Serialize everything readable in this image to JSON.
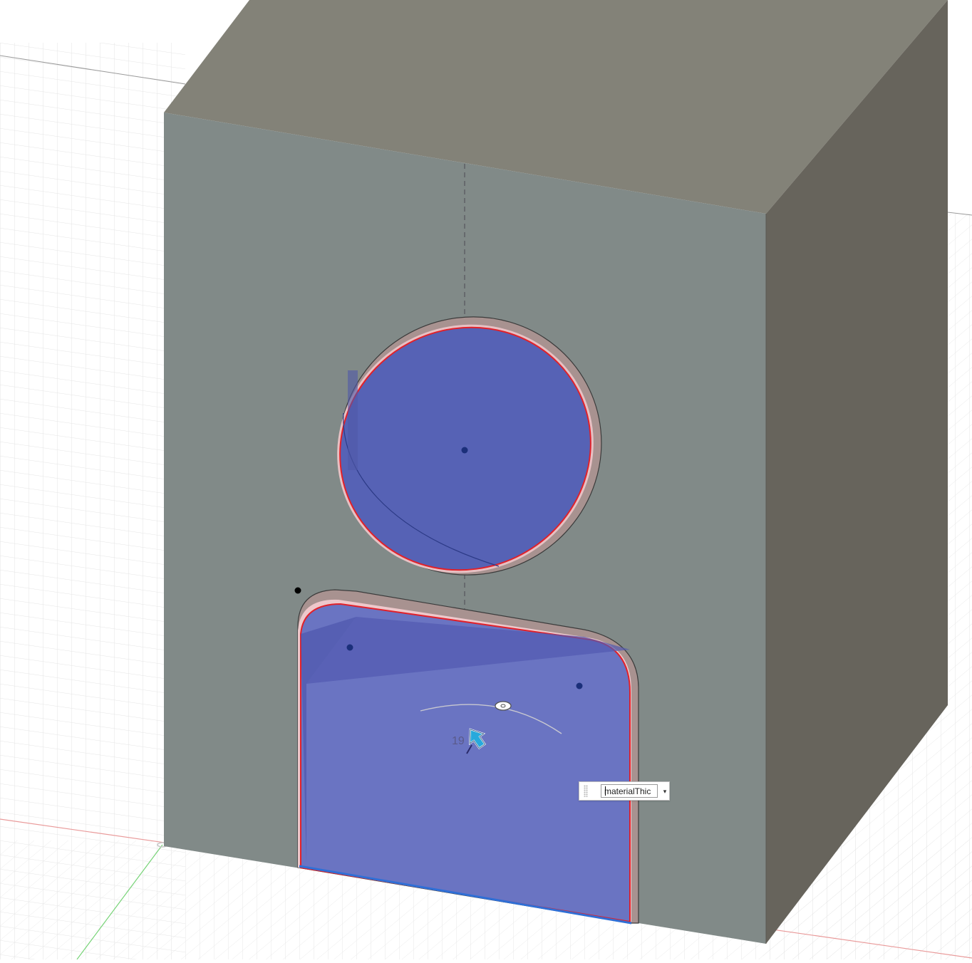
{
  "viewport": {
    "angle_readout": "19",
    "flange_input": {
      "value": "materialThic",
      "dropdown_glyph": "▾"
    }
  },
  "colors": {
    "body_front": "#818a88",
    "body_top": "#838278",
    "body_side": "#67645c",
    "selection_fill": "#5563b9",
    "selection_edge": "#e2202a",
    "grid_line": "#e3e3e3",
    "axis_x": "#e08080",
    "axis_y": "#66cc66"
  }
}
